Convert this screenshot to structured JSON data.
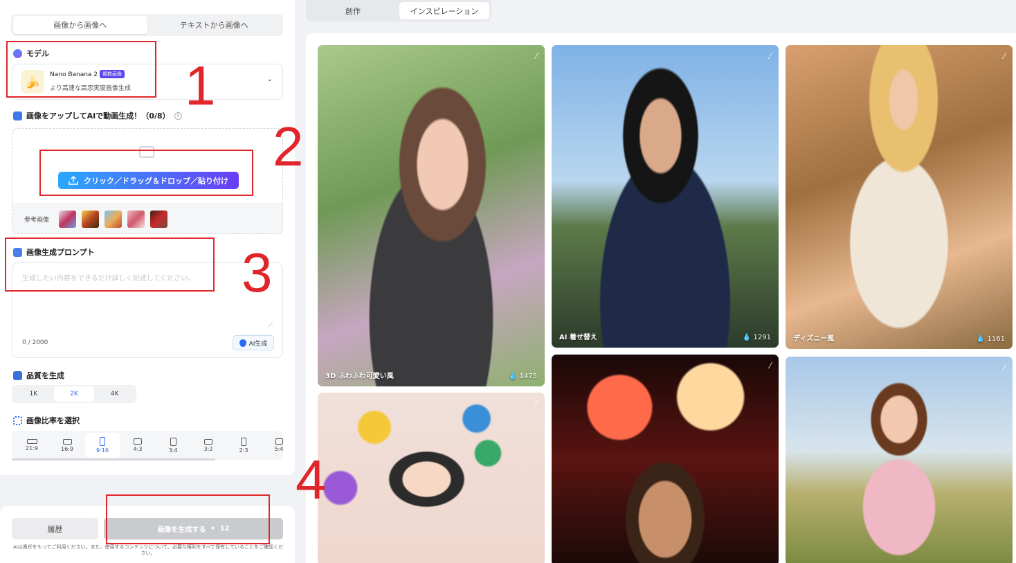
{
  "left_panel": {
    "mode_tabs": [
      "画像から画像へ",
      "テキストから画像へ"
    ],
    "model_section": {
      "title": "モデル",
      "model_name": "Nano Banana 2",
      "badge": "複数画像",
      "description": "より高速な高忠実度画像生成"
    },
    "upload_section": {
      "title": "画像をアップしてAIで動画生成！（0/8）",
      "button_label": "クリック／ドラッグ＆ドロップ／貼り付け",
      "reference_label": "参考画像"
    },
    "prompt_section": {
      "title": "画像生成プロンプト",
      "placeholder": "生成したい内容をできるだけ詳しく記述してください。",
      "counter": "0 / 2000",
      "ai_button": "AI生成"
    },
    "quality_section": {
      "title": "品質を生成",
      "options": [
        "1K",
        "2K",
        "4K"
      ],
      "selected": "2K"
    },
    "ratio_section": {
      "title": "画像比率を選択",
      "options": [
        "21:9",
        "16:9",
        "9:16",
        "4:3",
        "3:4",
        "3:2",
        "2:3",
        "5:4"
      ],
      "selected": "9:16"
    }
  },
  "bottom_bar": {
    "history_button": "履歴",
    "generate_button": "画像を生成する",
    "generate_cost": "12",
    "disclaimer": "AIは責任をもってご利用ください。また、使用するコンテンツについて、必要な権利をすべて保有していることをご確認ください。"
  },
  "top_tabs": [
    "創作",
    "インスピレーション"
  ],
  "gallery": [
    {
      "title": "3D ふわふわ可愛い風",
      "likes": "1475"
    },
    {
      "title": "AI 着せ替え",
      "likes": "1291"
    },
    {
      "title": "ディズニー風",
      "likes": "1161"
    },
    {
      "title": "",
      "likes": ""
    },
    {
      "title": "",
      "likes": ""
    },
    {
      "title": "",
      "likes": ""
    }
  ],
  "annotations": [
    "1",
    "2",
    "3",
    "4"
  ],
  "colors": {
    "accent": "#2b6bf3",
    "upload_gradient_start": "#2aa9ff",
    "upload_gradient_end": "#6a3df5",
    "annotation_red": "#e0262a"
  }
}
